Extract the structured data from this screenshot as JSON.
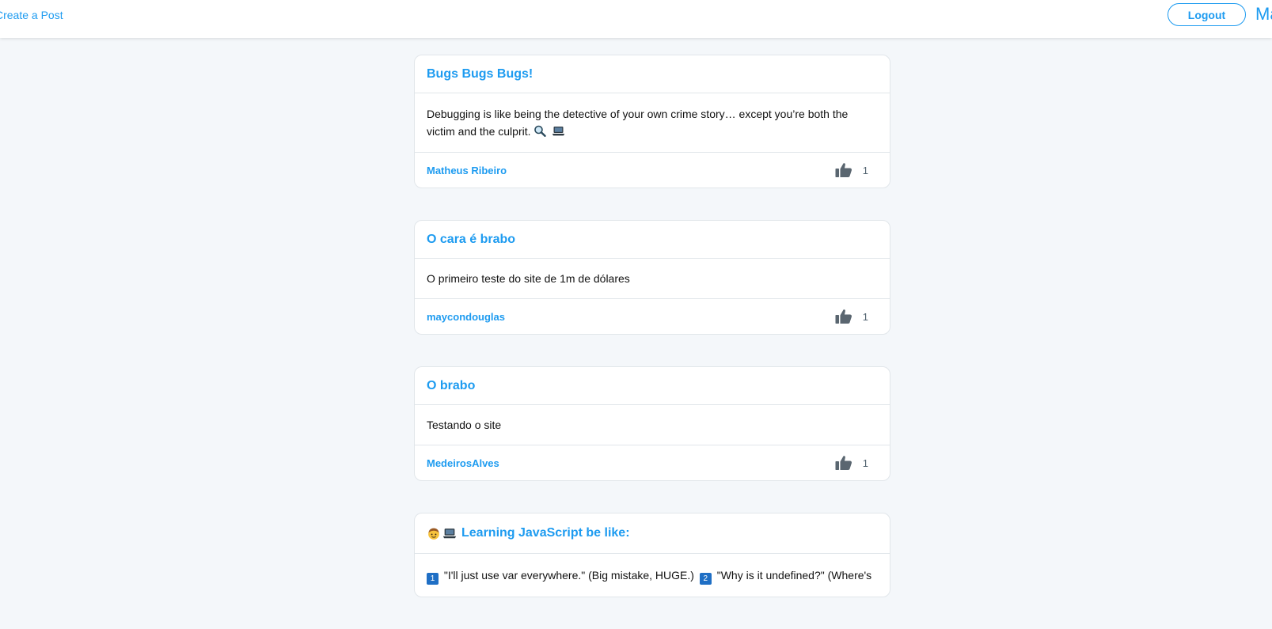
{
  "header": {
    "create_post_label": "Create a Post",
    "logout_label": "Logout",
    "user_name": "Ma",
    "accent_color": "#1d9bf0"
  },
  "posts": [
    {
      "title": "Bugs Bugs Bugs!",
      "body": "Debugging is like being the detective of your own crime story… except you’re both the victim and the culprit.",
      "body_icons": [
        "magnifier-icon",
        "laptop-icon"
      ],
      "author": "Matheus Ribeiro",
      "likes": "1"
    },
    {
      "title": "O cara é brabo",
      "body": "O primeiro teste do site de 1m de dólares",
      "author": "maycondouglas",
      "likes": "1"
    },
    {
      "title": "O brabo",
      "body": "Testando o site",
      "author": "MedeirosAlves",
      "likes": "1"
    },
    {
      "title_icons": [
        "boy-face-icon",
        "laptop-icon"
      ],
      "title": "Learning JavaScript be like:",
      "body_items": [
        {
          "num": "1",
          "text": "\"I'll just use var everywhere.\" (Big mistake, HUGE.)"
        },
        {
          "num": "2",
          "text": "\"Why is it undefined?\" (Where's"
        }
      ]
    }
  ]
}
